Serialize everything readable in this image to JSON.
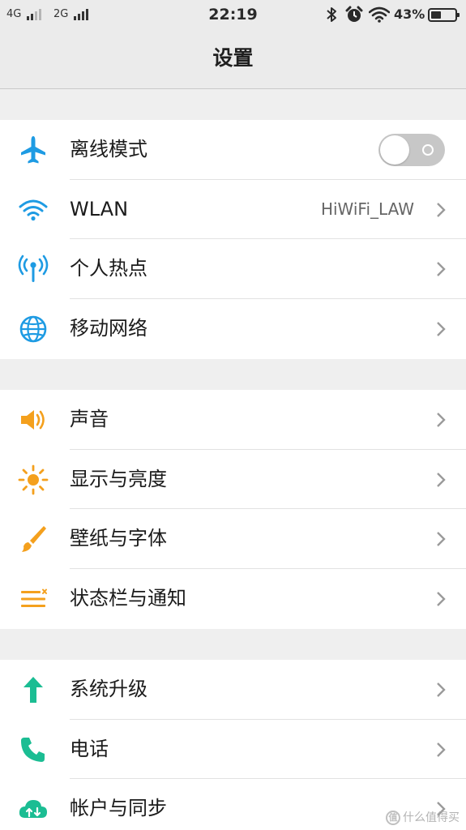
{
  "status_bar": {
    "net1": "4G",
    "net2": "2G",
    "time": "22:19",
    "battery_pct": "43%",
    "battery_level": 0.43,
    "icons": [
      "bluetooth-icon",
      "alarm-icon",
      "wifi-icon",
      "battery-icon"
    ]
  },
  "header": {
    "title": "设置"
  },
  "groups": [
    {
      "items": [
        {
          "label": "离线模式",
          "icon": "airplane-icon",
          "toggle": "off"
        },
        {
          "label": "WLAN",
          "value": "HiWiFi_LAW",
          "icon": "wifi-icon"
        },
        {
          "label": "个人热点",
          "icon": "hotspot-icon"
        },
        {
          "label": "移动网络",
          "icon": "globe-icon"
        }
      ]
    },
    {
      "items": [
        {
          "label": "声音",
          "icon": "speaker-icon"
        },
        {
          "label": "显示与亮度",
          "icon": "sun-icon"
        },
        {
          "label": "壁纸与字体",
          "icon": "brush-icon"
        },
        {
          "label": "状态栏与通知",
          "icon": "notification-menu-icon"
        }
      ]
    },
    {
      "items": [
        {
          "label": "系统升级",
          "icon": "arrow-up-icon"
        },
        {
          "label": "电话",
          "icon": "phone-icon"
        },
        {
          "label": "帐户与同步",
          "icon": "cloud-sync-icon"
        }
      ]
    }
  ],
  "colors": {
    "blue": "#1e9be3",
    "orange": "#f4a01d",
    "green": "#1bbd93",
    "toggle_off": "#c7c7c7",
    "background": "#efefef"
  },
  "watermark": {
    "text": "什么值得买"
  }
}
